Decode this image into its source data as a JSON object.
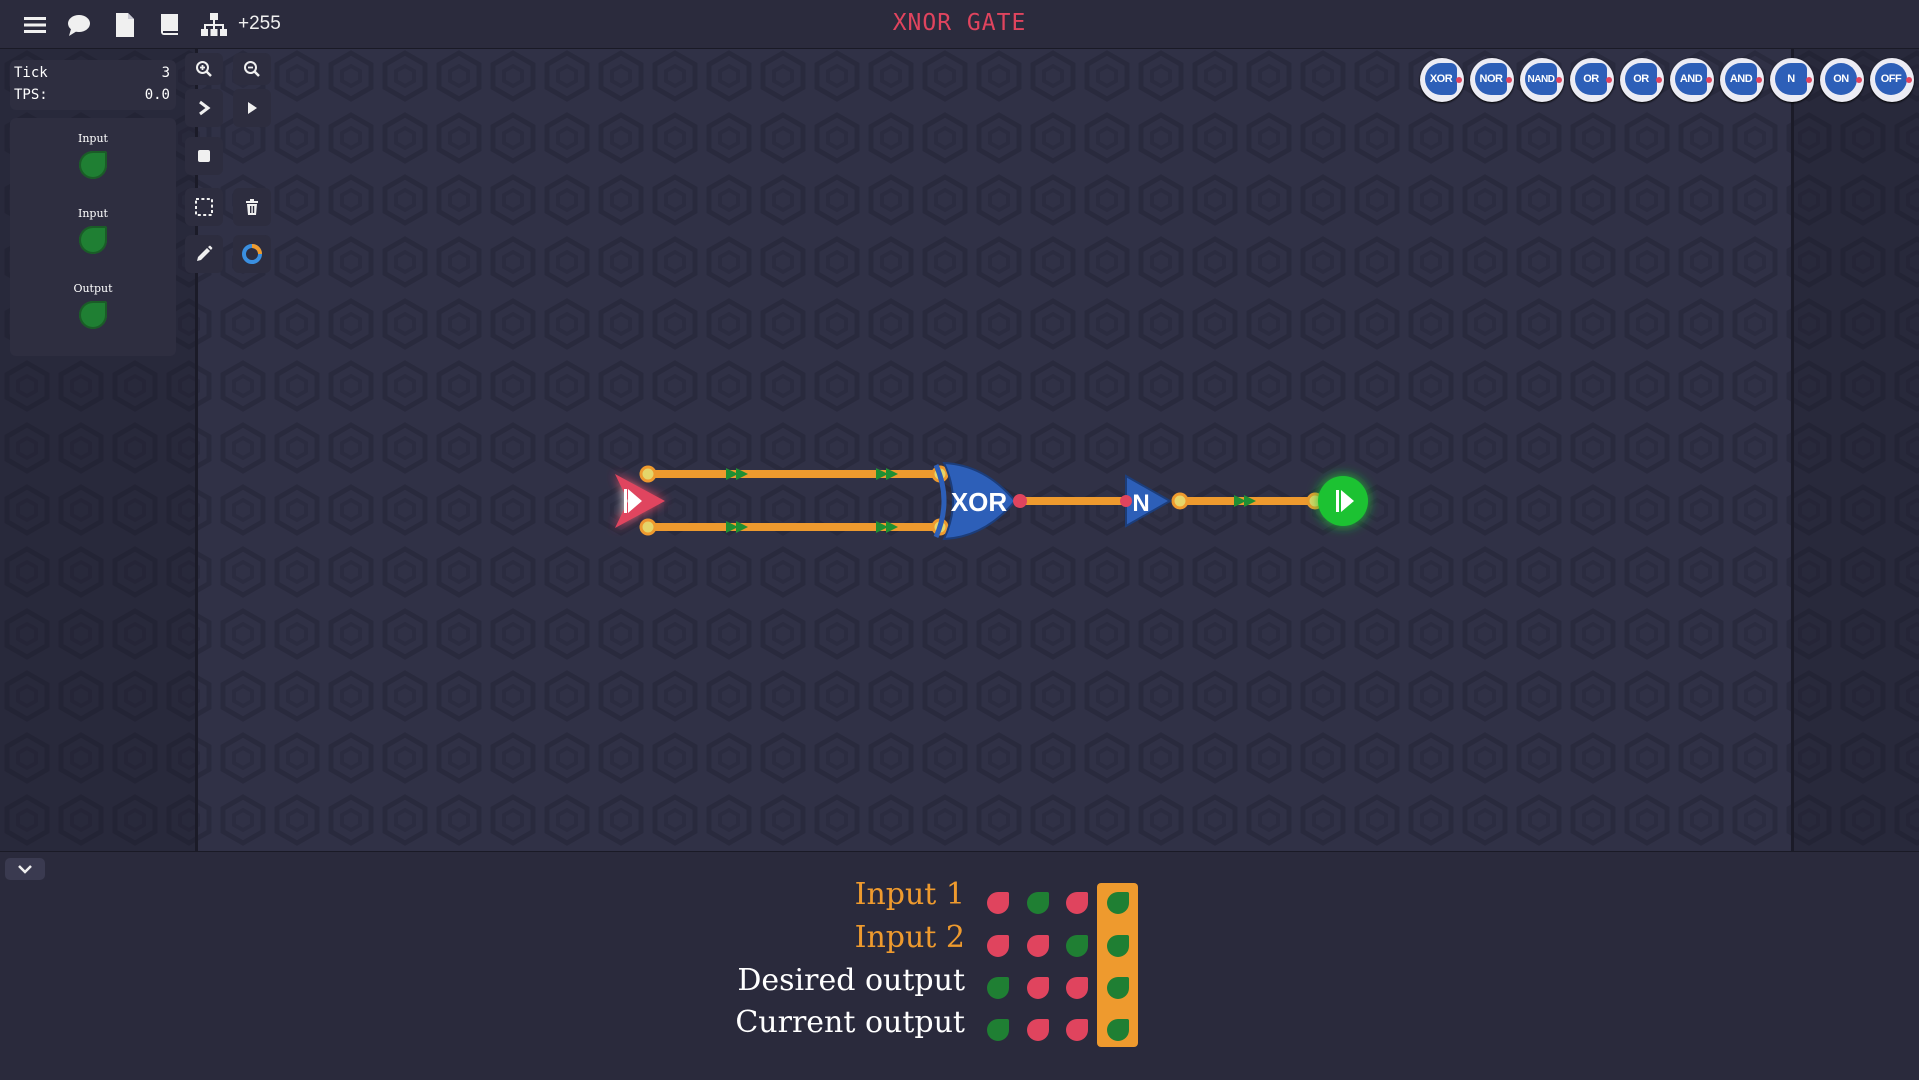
{
  "header": {
    "title": "XNOR GATE",
    "counter": "+255",
    "icons": [
      "menu-icon",
      "chat-icon",
      "document-icon",
      "book-icon",
      "hierarchy-icon"
    ]
  },
  "stats": {
    "tick_label": "Tick",
    "tick_value": "3",
    "tps_label": "TPS:",
    "tps_value": "0.0"
  },
  "io_panel": {
    "items": [
      {
        "label": "Input",
        "state": "on"
      },
      {
        "label": "Input",
        "state": "on"
      },
      {
        "label": "Output",
        "state": "on"
      }
    ]
  },
  "tools": [
    "zoom-in-icon",
    "zoom-out-icon",
    "step-icon",
    "play-icon",
    "stop-icon",
    "select-icon",
    "delete-icon",
    "pencil-icon",
    "color-icon"
  ],
  "palette": [
    {
      "label": "XOR"
    },
    {
      "label": "NOR"
    },
    {
      "label": "NAND"
    },
    {
      "label": "OR"
    },
    {
      "label": "OR"
    },
    {
      "label": "AND"
    },
    {
      "label": "AND"
    },
    {
      "label": "N"
    },
    {
      "label": "ON"
    },
    {
      "label": "OFF"
    }
  ],
  "circuit": {
    "xor_label": "XOR",
    "not_label": "N",
    "colors": {
      "wire": "#ee9a2e",
      "gate": "#2d5fb8",
      "on": "#1fc233",
      "off": "#e0445e"
    }
  },
  "truth_table": {
    "rows": [
      {
        "label": "Input 1",
        "color": "#ee9a2e",
        "values": [
          "off",
          "on",
          "off",
          "on"
        ]
      },
      {
        "label": "Input 2",
        "color": "#ee9a2e",
        "values": [
          "off",
          "off",
          "on",
          "on"
        ]
      },
      {
        "label": "Desired output",
        "color": "#ffffff",
        "values": [
          "on",
          "off",
          "off",
          "on"
        ]
      },
      {
        "label": "Current output",
        "color": "#ffffff",
        "values": [
          "on",
          "off",
          "off",
          "on"
        ]
      }
    ],
    "highlight_column": 3
  }
}
